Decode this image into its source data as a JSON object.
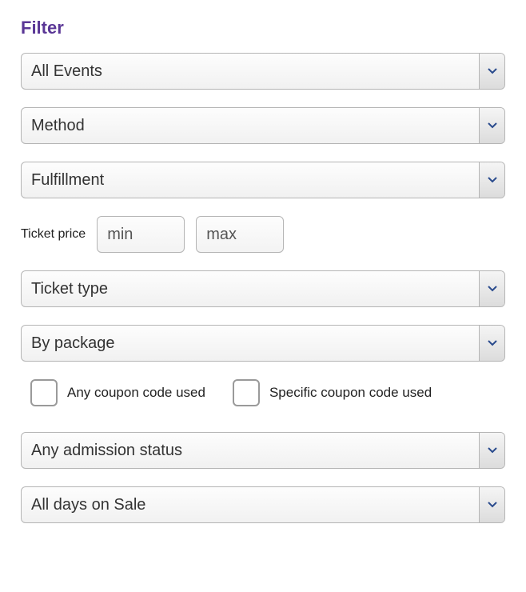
{
  "title": "Filter",
  "dropdowns": {
    "events": "All Events",
    "method": "Method",
    "fulfillment": "Fulfillment",
    "ticket_type": "Ticket type",
    "package": "By package",
    "admission": "Any admission status",
    "days_on_sale": "All days on Sale"
  },
  "price": {
    "label": "Ticket price",
    "min_placeholder": "min",
    "max_placeholder": "max"
  },
  "checks": {
    "any_coupon": "Any coupon code used",
    "specific_coupon": "Specific coupon code used"
  },
  "colors": {
    "accent": "#5a3696",
    "chevron": "#2a4b8d"
  }
}
